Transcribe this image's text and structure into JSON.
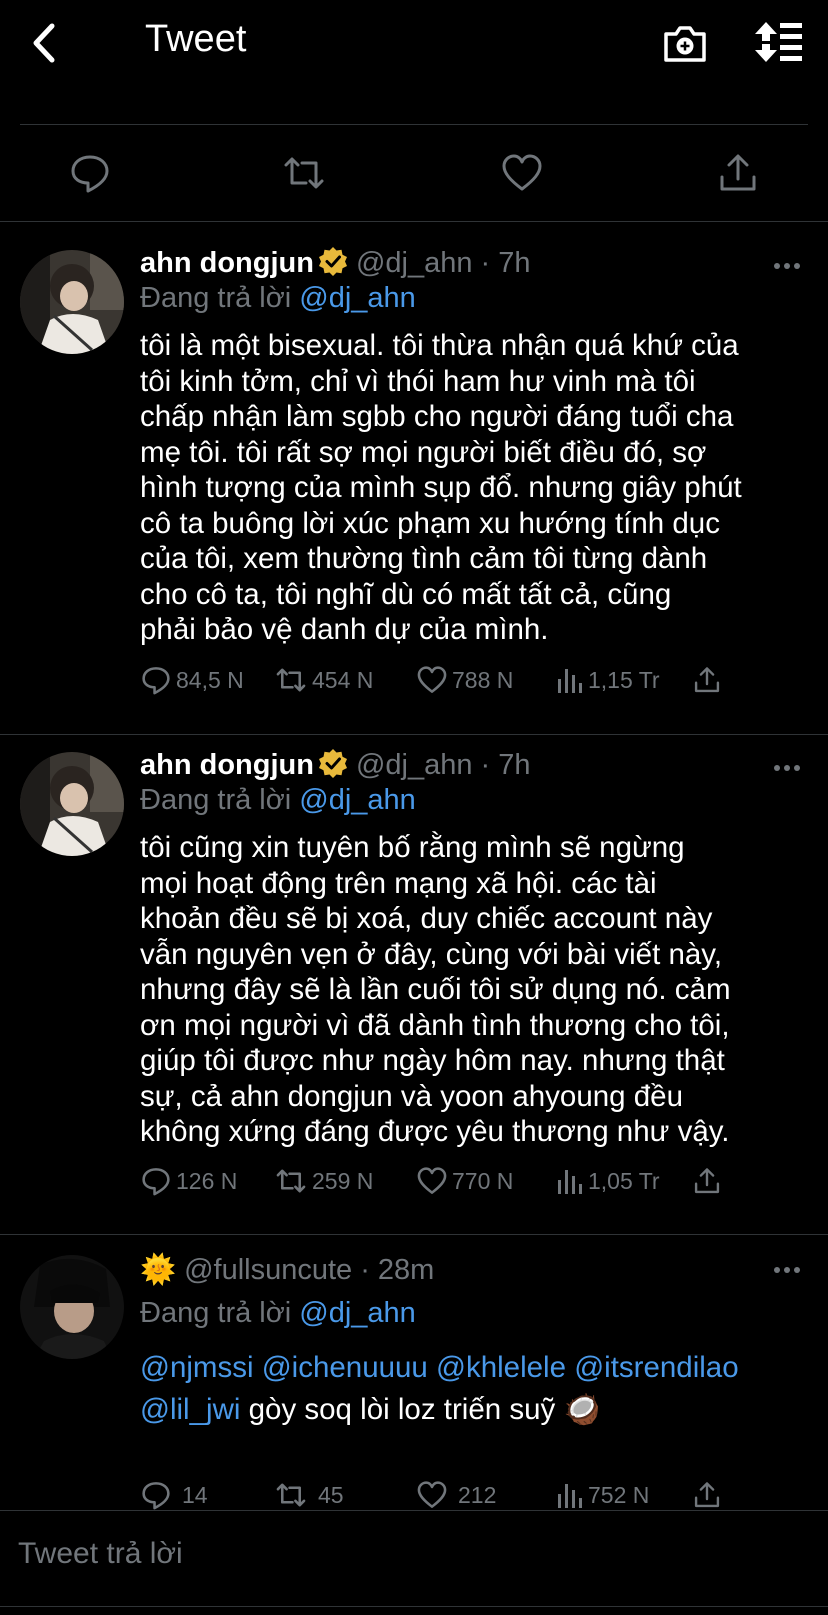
{
  "header": {
    "title": "Tweet",
    "back_icon": "chevron-left-icon",
    "camera_icon": "camera-plus-icon",
    "sort_icon": "sort-list-icon"
  },
  "action_bar": {
    "icons": [
      "reply-icon",
      "retweet-icon",
      "like-icon",
      "share-icon"
    ]
  },
  "tweets": [
    {
      "name": "ahn dongjun",
      "verified": true,
      "handle": "@dj_ahn",
      "time": "· 7h",
      "replying_label": "Đang trả lời",
      "replying_to": "@dj_ahn",
      "text_lines": [
        "tôi là một bisexual. tôi thừa nhận quá khứ của",
        "tôi kinh tởm, chỉ vì thói ham hư vinh mà tôi",
        "chấp nhận làm sgbb cho người đáng tuổi cha",
        "mẹ tôi. tôi rất sợ mọi người biết điều đó, sợ",
        "hình tượng của mình sụp đổ. nhưng giây phút",
        "cô ta buông lời xúc phạm xu hướng tính dục",
        "của tôi, xem thường tình cảm tôi từng dành",
        "cho cô ta, tôi nghĩ dù có mất tất cả, cũng",
        "phải bảo vệ danh dự của mình."
      ],
      "stats": {
        "replies": "84,5 N",
        "retweets": "454 N",
        "likes": "788 N",
        "views": "1,15 Tr"
      }
    },
    {
      "name": "ahn dongjun",
      "verified": true,
      "handle": "@dj_ahn",
      "time": "· 7h",
      "replying_label": "Đang trả lời",
      "replying_to": "@dj_ahn",
      "text_lines": [
        "tôi cũng xin tuyên bố rằng mình sẽ ngừng",
        "mọi hoạt động trên mạng xã hội. các tài",
        "khoản đều sẽ bị xoá, duy chiếc account này",
        "vẫn nguyên vẹn ở đây, cùng với bài viết này,",
        "nhưng đây sẽ là lần cuối tôi sử dụng nó. cảm",
        "ơn mọi người vì đã dành tình thương cho tôi,",
        "giúp tôi được như ngày hôm nay. nhưng thật",
        "sự, cả ahn dongjun và yoon ahyoung đều",
        "không xứng đáng được yêu thương như vậy."
      ],
      "stats": {
        "replies": "126 N",
        "retweets": "259 N",
        "likes": "770 N",
        "views": "1,05 Tr"
      }
    },
    {
      "name_emoji": "🌞",
      "handle": "@fullsuncute",
      "time": "· 28m",
      "replying_label": "Đang trả lời",
      "replying_to": "@dj_ahn",
      "mentions_line1": "@njmssi @ichenuuuu @khlelele @itsrendilao",
      "mention_line2": "@lil_jwi",
      "text_line2": " gòy soq lòi loz triến suỹ 🥥",
      "stats": {
        "replies": "14",
        "retweets": "45",
        "likes": "212",
        "views": "752 N"
      }
    }
  ],
  "reply_input": {
    "placeholder": "Tweet trả lời"
  },
  "colors": {
    "background": "#000000",
    "text": "#ffffff",
    "muted": "#71767b",
    "link": "#4a99e9",
    "verified": "#e8b93b"
  }
}
